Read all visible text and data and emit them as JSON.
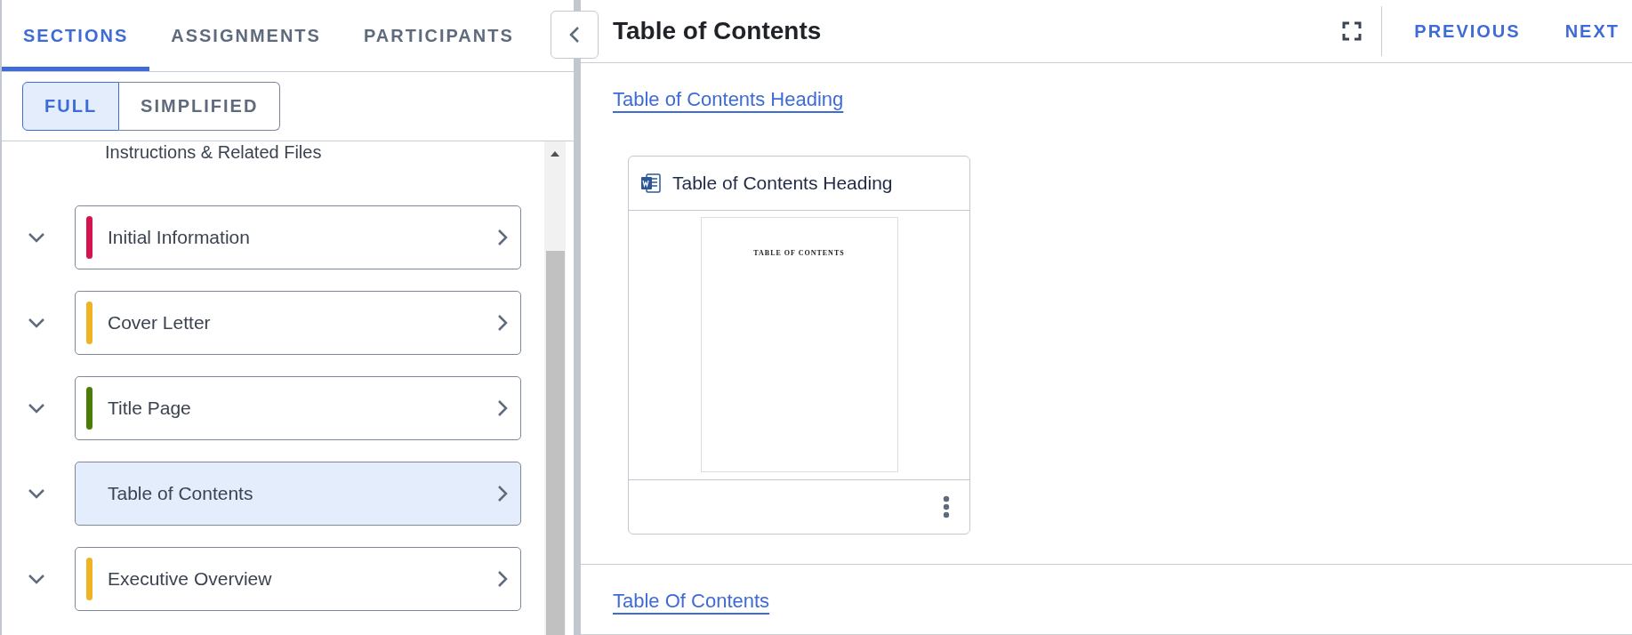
{
  "tabs": [
    {
      "label": "SECTIONS",
      "selected": true
    },
    {
      "label": "ASSIGNMENTS",
      "selected": false
    },
    {
      "label": "PARTICIPANTS",
      "selected": false
    }
  ],
  "view_toggle": [
    {
      "label": "FULL",
      "selected": true
    },
    {
      "label": "SIMPLIFIED",
      "selected": false
    }
  ],
  "sections_header": "Instructions & Related Files",
  "sections": [
    {
      "label": "Initial Information",
      "color": "#d4134f",
      "selected": false
    },
    {
      "label": "Cover Letter",
      "color": "#f0b323",
      "selected": false
    },
    {
      "label": "Title Page",
      "color": "#4b7d06",
      "selected": false
    },
    {
      "label": "Table of Contents",
      "selected": true
    },
    {
      "label": "Executive Overview",
      "color": "#f0b323",
      "selected": false
    }
  ],
  "content": {
    "title": "Table of Contents",
    "previous": "PREVIOUS",
    "next": "NEXT",
    "blocks": [
      {
        "link": "Table of Contents Heading",
        "file": {
          "name": "Table of Contents Heading",
          "preview_text": "TABLE OF CONTENTS"
        }
      },
      {
        "link": "Table Of Contents"
      }
    ]
  }
}
